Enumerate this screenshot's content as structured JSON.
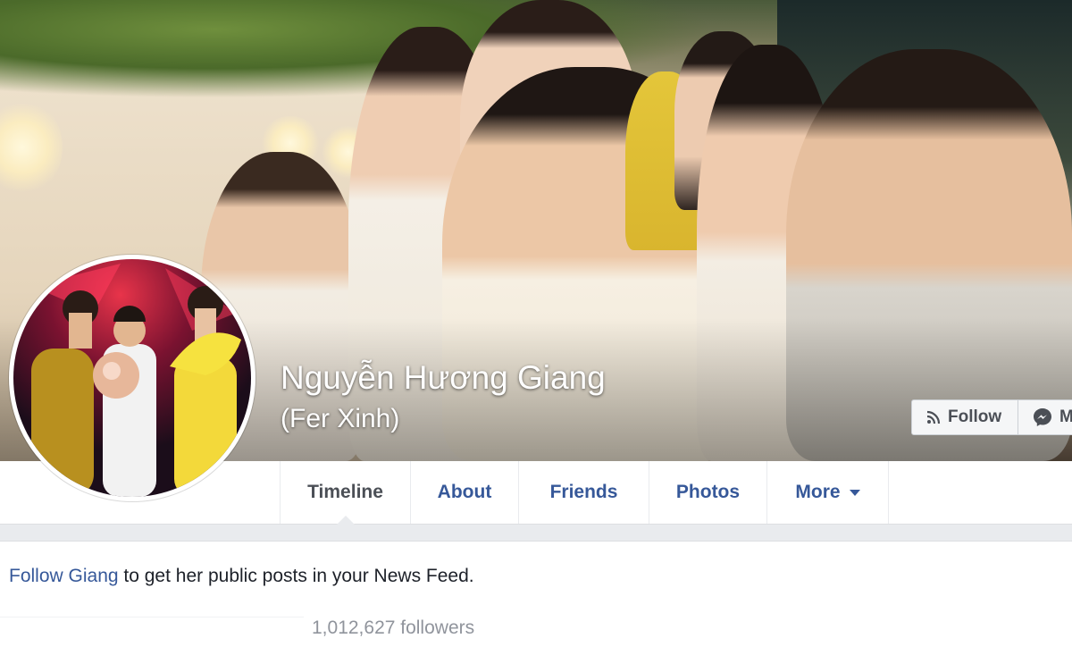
{
  "profile": {
    "name": "Nguyễn Hương Giang",
    "alternate_name": "(Fer Xinh)"
  },
  "cover_actions": {
    "follow_label": "Follow",
    "message_label": "M"
  },
  "tabs": [
    {
      "label": "Timeline",
      "active": true
    },
    {
      "label": "About",
      "active": false
    },
    {
      "label": "Friends",
      "active": false
    },
    {
      "label": "Photos",
      "active": false
    },
    {
      "label": "More",
      "active": false
    }
  ],
  "follow_prompt": {
    "link": "Follow Giang",
    "rest": " to get her public posts in your News Feed."
  },
  "followers": "1,012,627 followers",
  "colors": {
    "link": "#365899",
    "muted": "#90949c",
    "border": "#dddfe2",
    "background_gray": "#e9ebee"
  }
}
